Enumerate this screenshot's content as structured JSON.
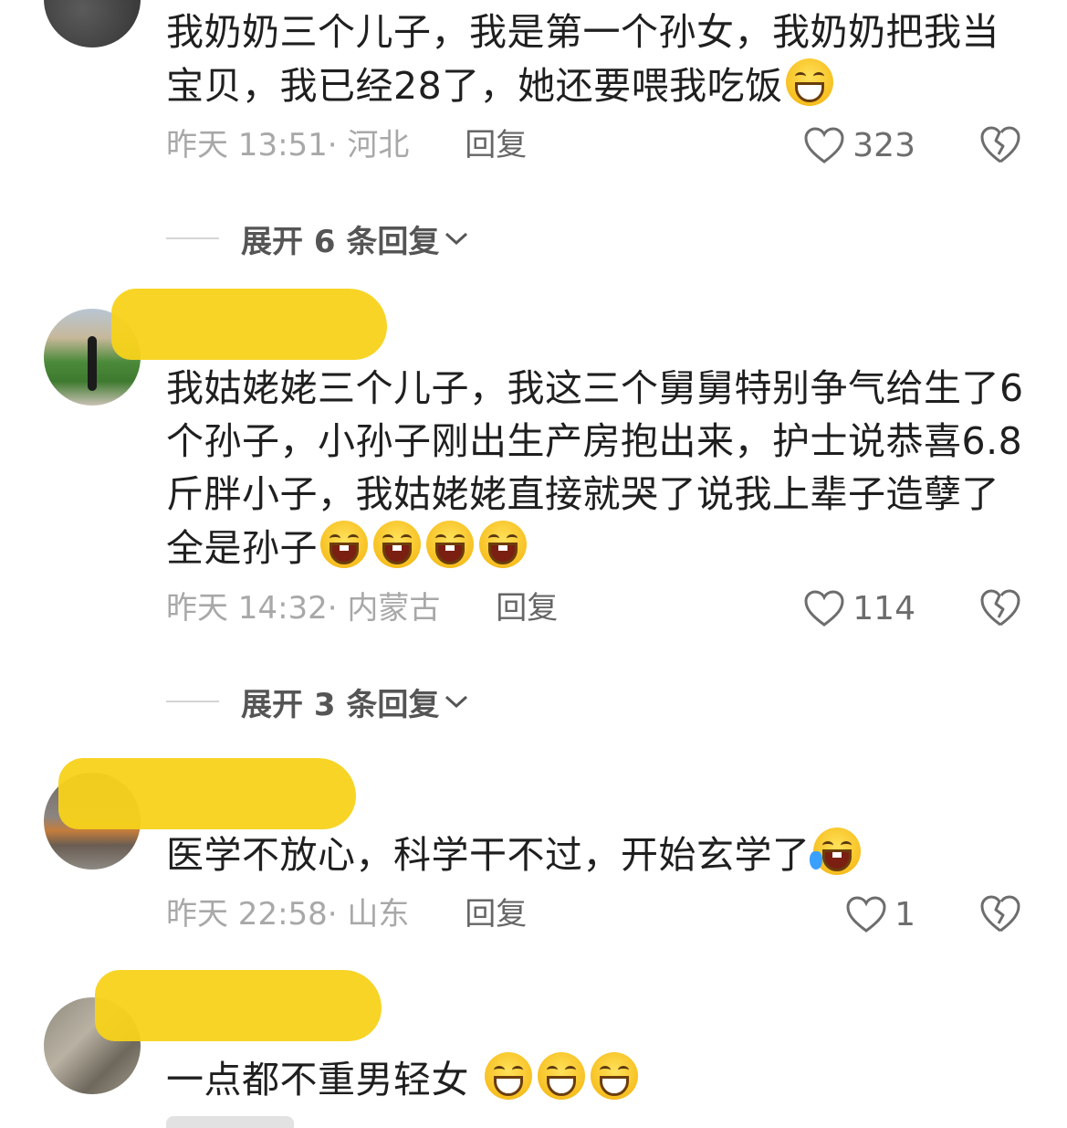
{
  "comments": [
    {
      "text": "我奶奶三个儿子，我是第一个孙女，我奶奶把我当宝贝，我已经28了，她还要喂我吃饭",
      "time_location": "昨天 13:51· 河北",
      "reply_label": "回复",
      "likes": "323",
      "emojis": [
        "grin-sweat"
      ]
    },
    {
      "text": "我姑姥姥三个儿子，我这三个舅舅特别争气给生了6个孙子，小孙子刚出生产房抱出来，护士说恭喜6.8斤胖小子，我姑姥姥直接就哭了说我上辈子造孽了全是孙子",
      "time_location": "昨天 14:32· 内蒙古",
      "reply_label": "回复",
      "likes": "114",
      "emojis": [
        "laugh",
        "laugh",
        "laugh",
        "laugh"
      ]
    },
    {
      "text": "医学不放心，科学干不过，开始玄学了",
      "time_location": "昨天 22:58· 山东",
      "reply_label": "回复",
      "likes": "1",
      "emojis": [
        "tears-of-joy"
      ]
    },
    {
      "text": "一点都不重男轻女",
      "emojis": [
        "grin",
        "grin",
        "grin"
      ]
    }
  ],
  "expand_replies": [
    {
      "label": "展开 6 条回复"
    },
    {
      "label": "展开 3 条回复"
    }
  ],
  "colors": {
    "redaction": "#f7d21a",
    "meta_text": "#a8a8a8",
    "main_text": "#1f1f1f"
  }
}
